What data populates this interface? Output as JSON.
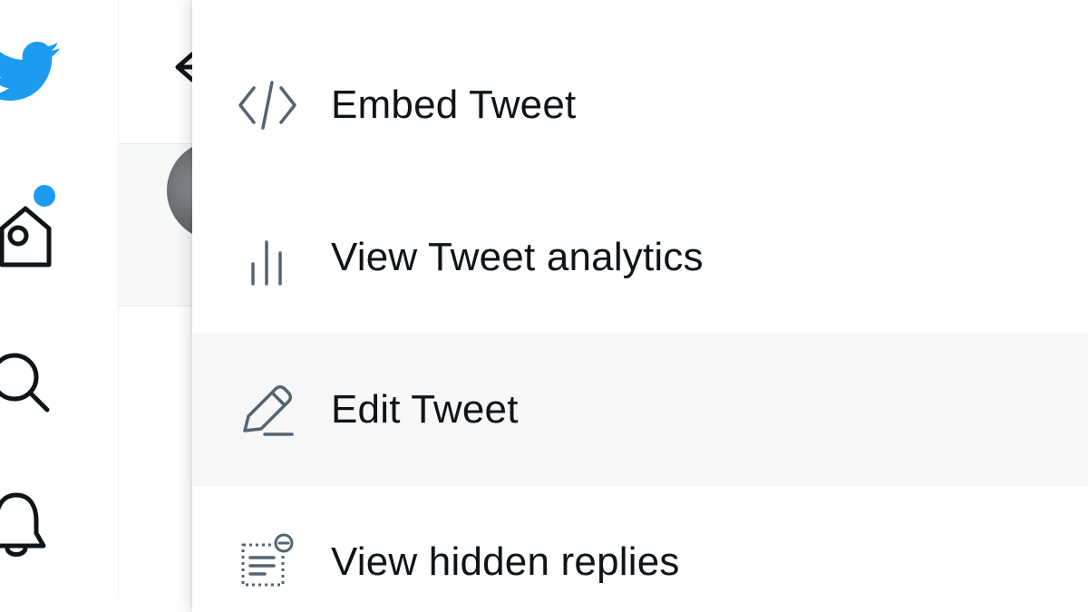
{
  "colors": {
    "brand": "#1d9bf0",
    "text": "#0f1419",
    "icon": "#536471",
    "highlight_bg": "#f7f7f7"
  },
  "nav": {
    "items": [
      {
        "icon": "twitter-logo-icon"
      },
      {
        "icon": "home-icon",
        "has_notification_dot": true
      },
      {
        "icon": "search-icon"
      },
      {
        "icon": "bell-icon"
      }
    ]
  },
  "background": {
    "back_icon": "back-arrow-icon"
  },
  "menu": {
    "items": [
      {
        "label": "Embed Tweet",
        "icon": "code-icon"
      },
      {
        "label": "View Tweet analytics",
        "icon": "analytics-icon"
      },
      {
        "label": "Edit Tweet",
        "icon": "edit-pencil-icon",
        "highlighted": true
      },
      {
        "label": "View hidden replies",
        "icon": "hidden-replies-icon"
      }
    ]
  }
}
